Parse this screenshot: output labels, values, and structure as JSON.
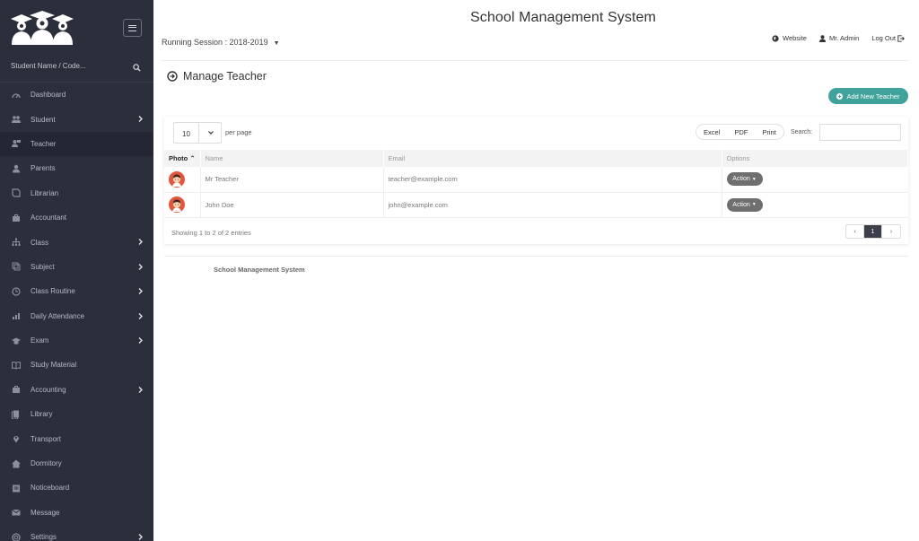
{
  "sidebar": {
    "search_placeholder": "Student Name / Code...",
    "items": [
      {
        "label": "Dashboard",
        "icon": "dashboard-icon",
        "chevron": false
      },
      {
        "label": "Student",
        "icon": "users-icon",
        "chevron": true
      },
      {
        "label": "Teacher",
        "icon": "teacher-icon",
        "chevron": false,
        "active": true
      },
      {
        "label": "Parents",
        "icon": "user-icon",
        "chevron": false
      },
      {
        "label": "Librarian",
        "icon": "book-icon",
        "chevron": false
      },
      {
        "label": "Accountant",
        "icon": "briefcase-icon",
        "chevron": false
      },
      {
        "label": "Class",
        "icon": "hierarchy-icon",
        "chevron": true
      },
      {
        "label": "Subject",
        "icon": "copy-icon",
        "chevron": true
      },
      {
        "label": "Class Routine",
        "icon": "clock-icon",
        "chevron": true
      },
      {
        "label": "Daily Attendance",
        "icon": "bar-chart-icon",
        "chevron": true
      },
      {
        "label": "Exam",
        "icon": "graduation-cap-icon",
        "chevron": true
      },
      {
        "label": "Study Material",
        "icon": "open-book-icon",
        "chevron": false
      },
      {
        "label": "Accounting",
        "icon": "briefcase-icon",
        "chevron": true
      },
      {
        "label": "Library",
        "icon": "files-icon",
        "chevron": false
      },
      {
        "label": "Transport",
        "icon": "map-pin-icon",
        "chevron": false
      },
      {
        "label": "Dormitory",
        "icon": "home-icon",
        "chevron": false
      },
      {
        "label": "Noticeboard",
        "icon": "calendar-icon",
        "chevron": false
      },
      {
        "label": "Message",
        "icon": "envelope-icon",
        "chevron": false
      },
      {
        "label": "Settings",
        "icon": "lifebuoy-icon",
        "chevron": true
      }
    ]
  },
  "header": {
    "title": "School Management System",
    "session_label": "Running Session : 2018-2019",
    "links": {
      "website": "Website",
      "user": "Mr. Admin",
      "logout": "Log Out"
    }
  },
  "page": {
    "title": "Manage Teacher",
    "add_button": "Add New Teacher"
  },
  "table_controls": {
    "per_page_value": "10",
    "per_page_label": "per page",
    "exports": [
      "Excel",
      "PDF",
      "Print"
    ],
    "search_label": "Search:",
    "search_value": ""
  },
  "table": {
    "columns": [
      "Photo",
      "Name",
      "Email",
      "Options"
    ],
    "sorted_column": "Photo",
    "rows": [
      {
        "name": "Mr Teacher",
        "email": "teacher@example.com",
        "action": "Action"
      },
      {
        "name": "John Doe",
        "email": "john@example.com",
        "action": "Action"
      }
    ],
    "showing": "Showing 1 to 2 of 2 entries",
    "pagination": {
      "prev": "‹",
      "current": "1",
      "next": "›"
    }
  },
  "footer": {
    "text": "School Management System"
  },
  "colors": {
    "sidebar_bg": "#2b2e3b",
    "accent": "#3fa39b",
    "action_btn": "#6f6f6f"
  }
}
